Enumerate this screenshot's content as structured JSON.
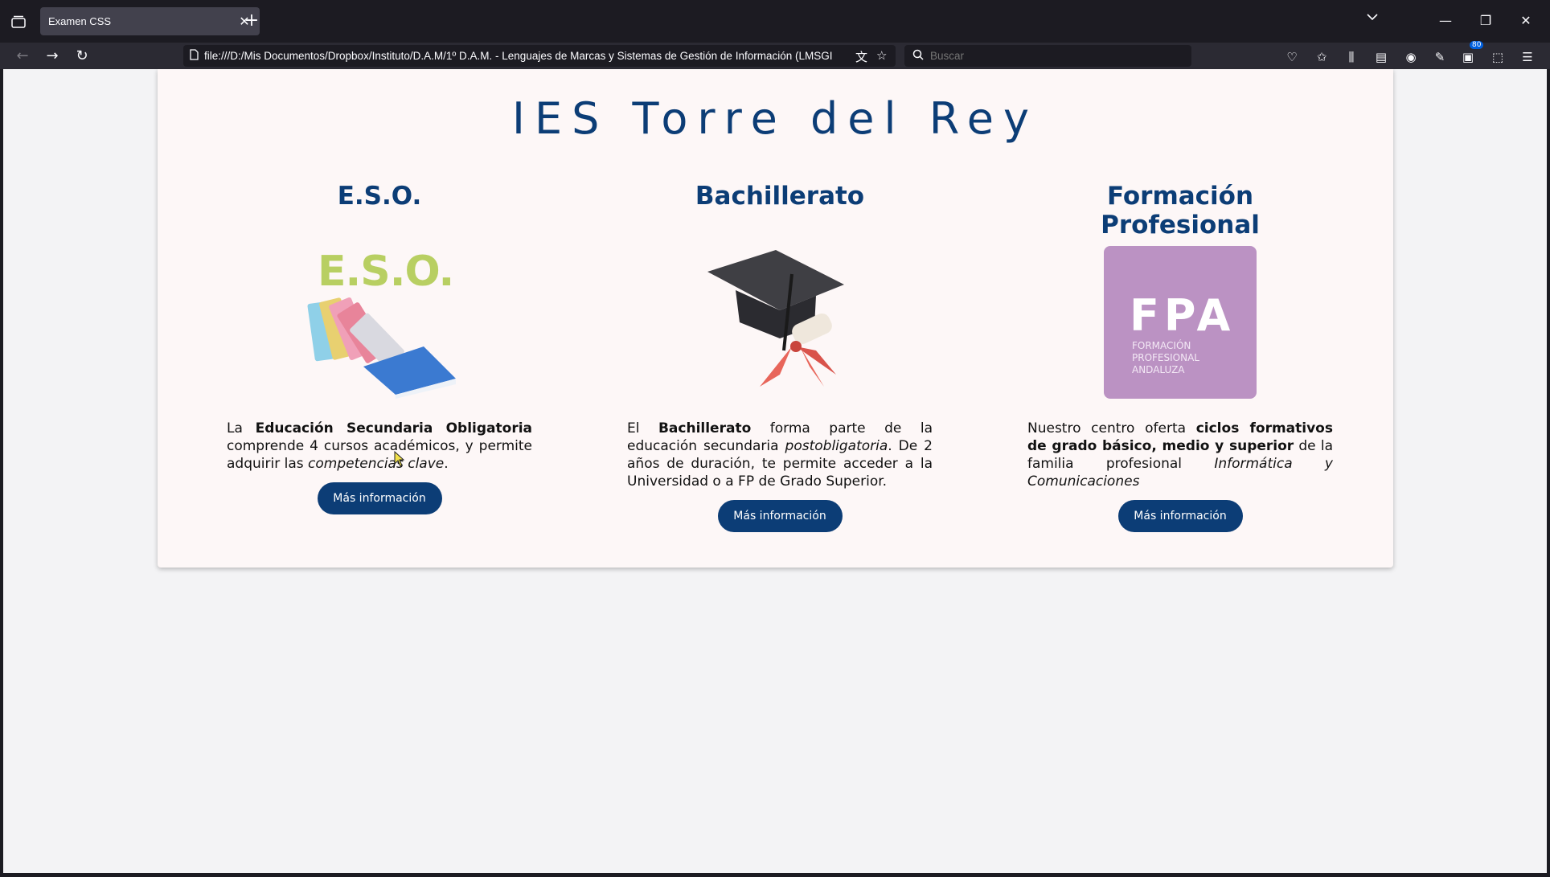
{
  "browser": {
    "tab_title": "Examen CSS",
    "url": "file:///D:/Mis Documentos/Dropbox/Instituto/D.A.M/1º D.A.M. - Lenguajes de Marcas y Sistemas de Gestión de Información (LMSGI",
    "search_placeholder": "Buscar",
    "badge_count": "80"
  },
  "page": {
    "title": "IES Torre del Rey",
    "button_label": "Más información",
    "columns": [
      {
        "title": "E.S.O.",
        "image_text": "E.S.O.",
        "text_parts": [
          "La ",
          "Educación Secundaria Obligatoria",
          " comprende 4 cursos académicos, y permite adquirir las ",
          "competencias clave",
          "."
        ]
      },
      {
        "title": "Bachillerato",
        "text_parts": [
          "El ",
          "Bachillerato",
          " forma parte de la educación secundaria ",
          "postobligatoria",
          ". De 2 años de duración, te permite acceder a la Universidad o a FP de Grado Superior."
        ]
      },
      {
        "title": "Formación Profesional",
        "image_big": "FPA",
        "image_small": [
          "FORMACIÓN",
          "PROFESIONAL",
          "ANDALUZA"
        ],
        "text_parts": [
          "Nuestro centro oferta ",
          "ciclos formativos de grado básico, medio y superior",
          " de la familia profesional ",
          "Informática y Comunicaciones"
        ]
      }
    ]
  },
  "colors": {
    "accent": "#0c3d76",
    "fpa": "#bb92c3",
    "eso_title": "#b8cf62"
  }
}
